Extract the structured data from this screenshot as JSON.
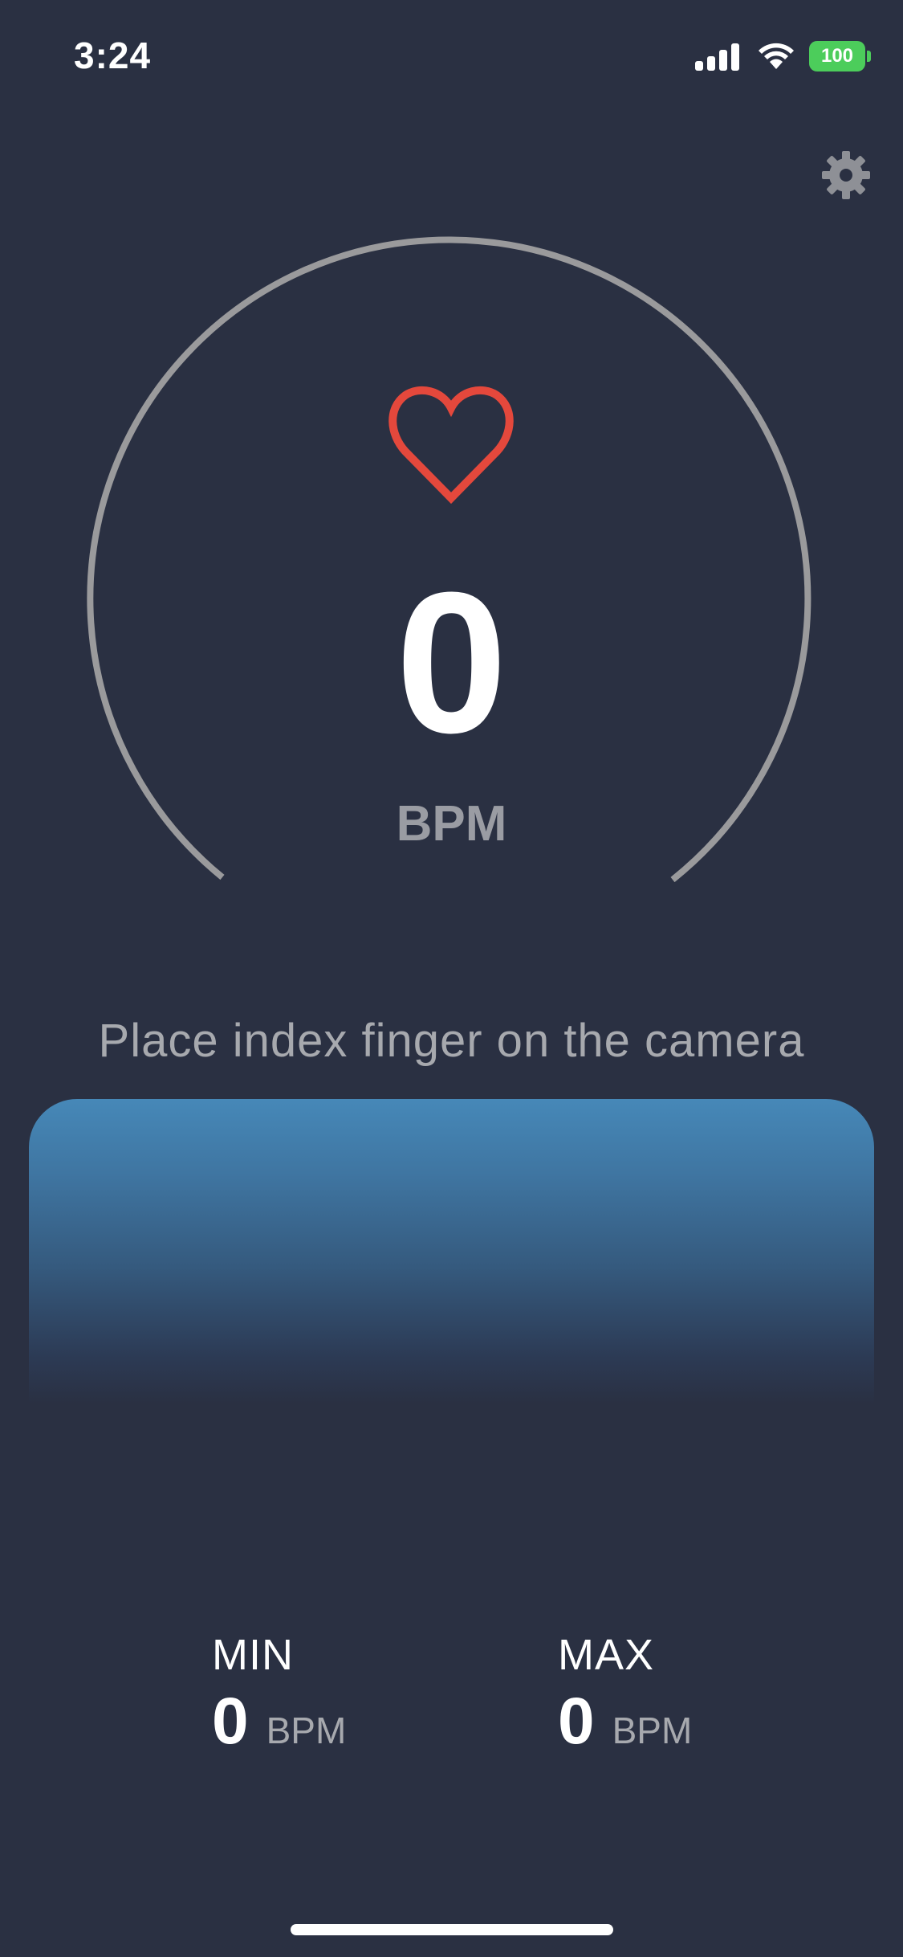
{
  "status_bar": {
    "time": "3:24",
    "battery": "100",
    "icons": [
      "signal-icon",
      "wifi-icon",
      "battery-icon"
    ]
  },
  "header": {
    "settings_icon": "gear-icon"
  },
  "gauge": {
    "icon": "heart-icon",
    "value": "0",
    "unit": "BPM"
  },
  "instruction": "Place index finger on the camera",
  "stats": {
    "min": {
      "label": "MIN",
      "value": "0",
      "unit": "BPM"
    },
    "max": {
      "label": "MAX",
      "value": "0",
      "unit": "BPM"
    }
  },
  "colors": {
    "background": "#2a3042",
    "heart": "#e4483c",
    "gauge_arc": "#9a9a9c",
    "wave_top": "#4688b8",
    "battery": "#4ccd5b"
  }
}
